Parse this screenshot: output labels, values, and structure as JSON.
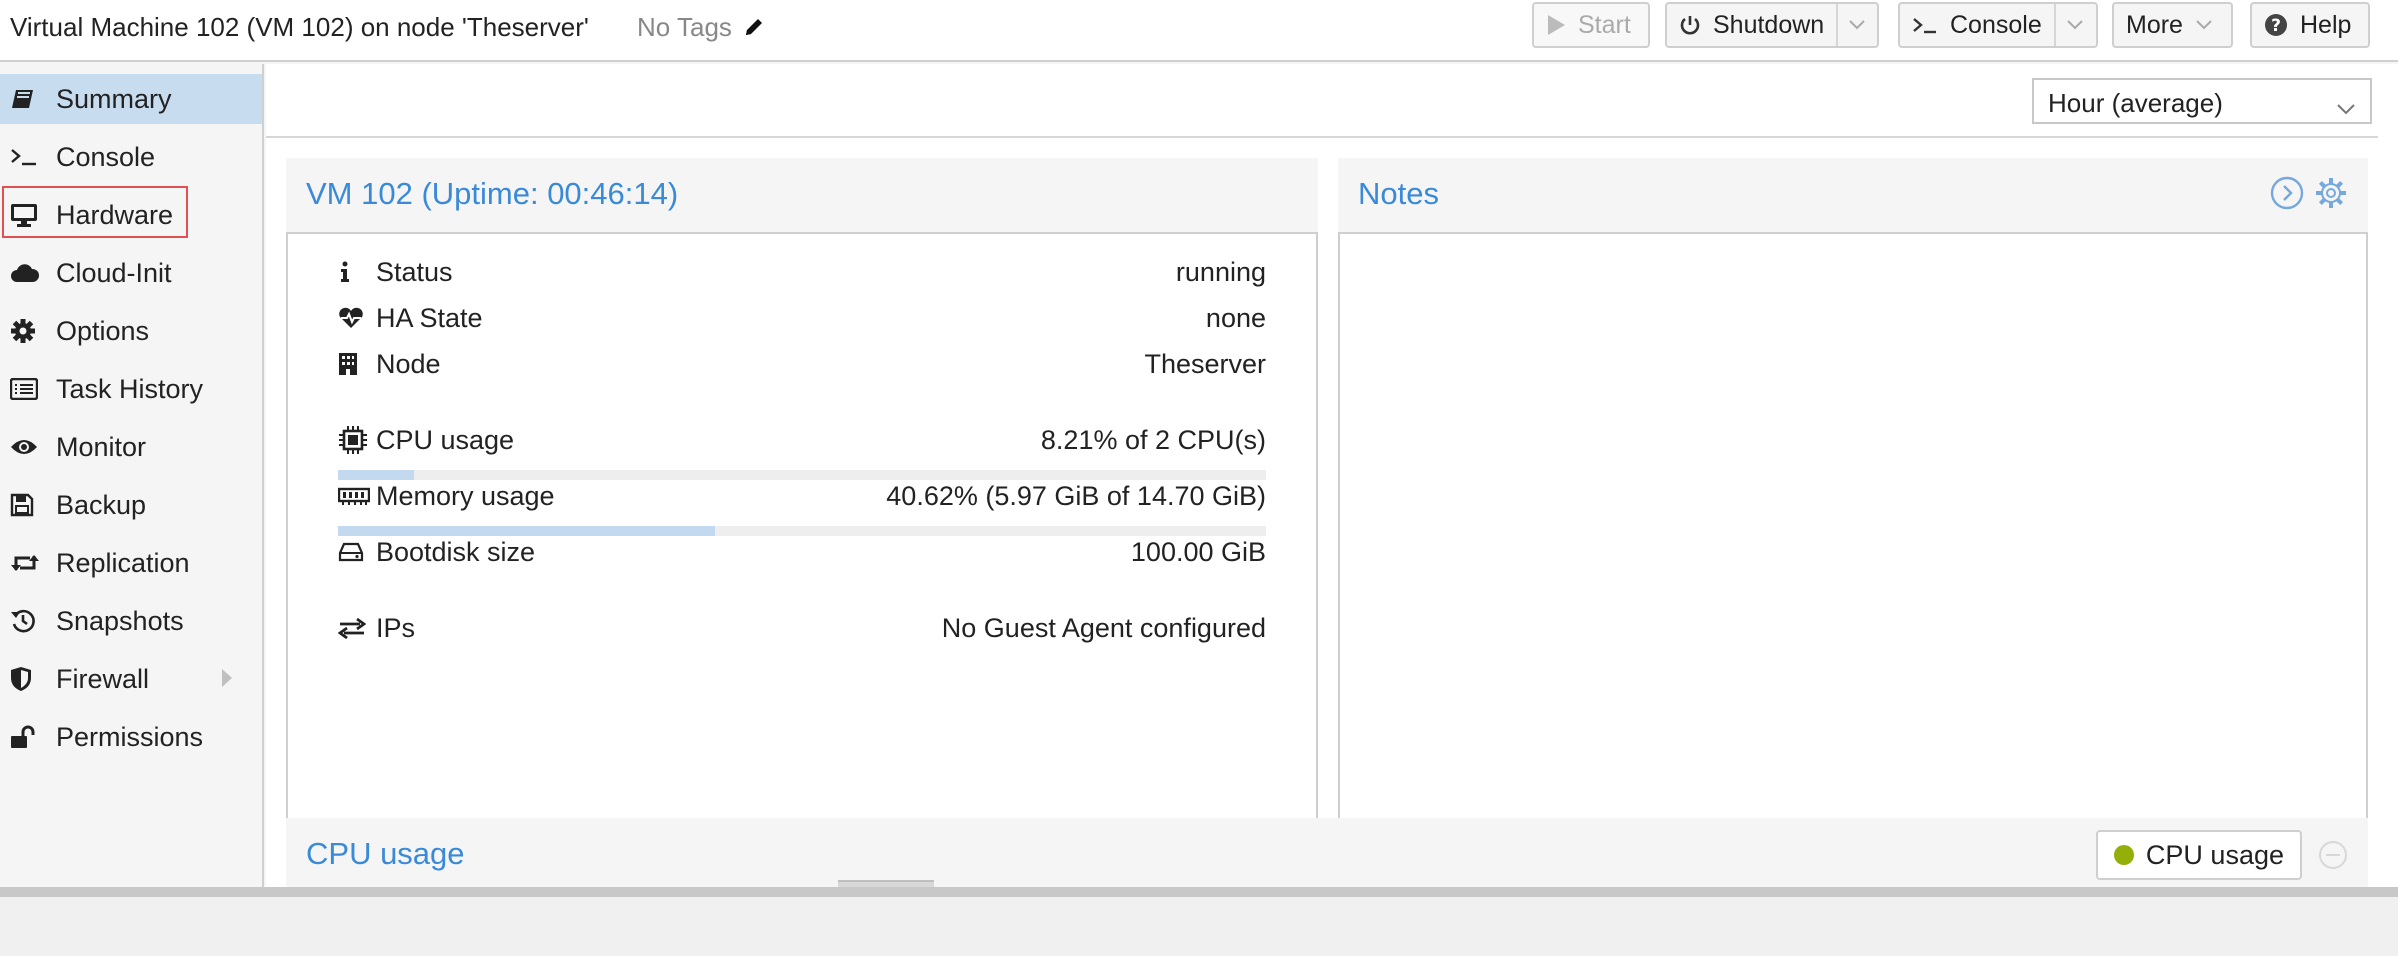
{
  "header": {
    "title": "Virtual Machine 102 (VM 102) on node 'Theserver'",
    "tags": "No Tags",
    "buttons": {
      "start": "Start",
      "shutdown": "Shutdown",
      "console": "Console",
      "more": "More",
      "help": "Help"
    }
  },
  "sidebar": {
    "items": [
      {
        "label": "Summary",
        "icon": "book-icon"
      },
      {
        "label": "Console",
        "icon": "terminal-icon"
      },
      {
        "label": "Hardware",
        "icon": "desktop-icon"
      },
      {
        "label": "Cloud-Init",
        "icon": "cloud-icon"
      },
      {
        "label": "Options",
        "icon": "gear-icon"
      },
      {
        "label": "Task History",
        "icon": "list-icon"
      },
      {
        "label": "Monitor",
        "icon": "eye-icon"
      },
      {
        "label": "Backup",
        "icon": "floppy-icon"
      },
      {
        "label": "Replication",
        "icon": "retweet-icon"
      },
      {
        "label": "Snapshots",
        "icon": "history-icon"
      },
      {
        "label": "Firewall",
        "icon": "shield-icon"
      },
      {
        "label": "Permissions",
        "icon": "unlock-icon"
      }
    ],
    "active_index": 0,
    "highlighted_index": 2
  },
  "time_range": {
    "selected": "Hour (average)"
  },
  "summary": {
    "title": "VM 102 (Uptime: 00:46:14)",
    "status": {
      "label": "Status",
      "value": "running"
    },
    "ha_state": {
      "label": "HA State",
      "value": "none"
    },
    "node": {
      "label": "Node",
      "value": "Theserver"
    },
    "cpu": {
      "label": "CPU usage",
      "value": "8.21% of 2 CPU(s)",
      "fraction": 0.0821
    },
    "memory": {
      "label": "Memory usage",
      "value": "40.62% (5.97 GiB of 14.70 GiB)",
      "fraction": 0.4062
    },
    "bootdisk": {
      "label": "Bootdisk size",
      "value": "100.00 GiB"
    },
    "ips": {
      "label": "IPs",
      "value": "No Guest Agent configured"
    }
  },
  "notes": {
    "title": "Notes"
  },
  "cpu_chart": {
    "title": "CPU usage",
    "legend": "CPU usage",
    "legend_color": "#94ae0a"
  },
  "colors": {
    "accent": "#3a8ad8",
    "selected": "#c8dcf0",
    "highlight_border": "#e05050"
  }
}
